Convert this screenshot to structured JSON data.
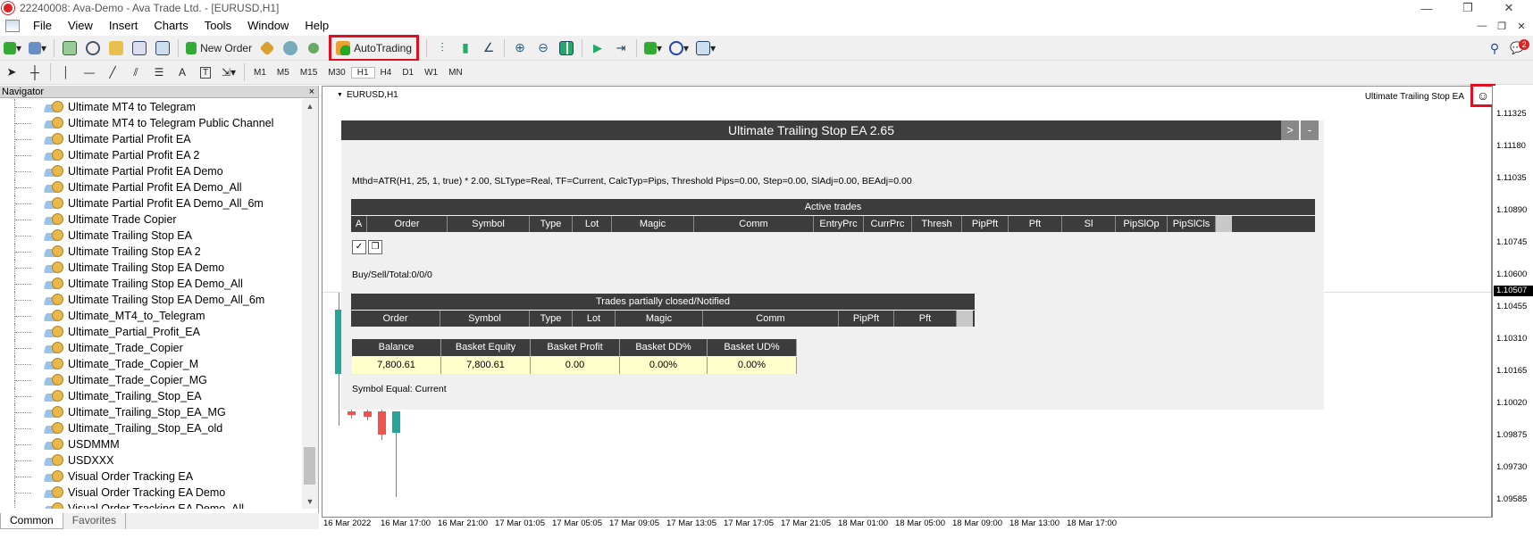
{
  "window": {
    "title": "22240008: Ava-Demo - Ava Trade Ltd. - [EURUSD,H1]",
    "controls": [
      "—",
      "❐",
      "✕"
    ]
  },
  "menu": {
    "items": [
      "File",
      "View",
      "Insert",
      "Charts",
      "Tools",
      "Window",
      "Help"
    ],
    "mdi_controls": [
      "—",
      "❐",
      "✕"
    ]
  },
  "toolbar": {
    "new_order_label": "New Order",
    "autotrading_label": "AutoTrading",
    "notification_count": "2"
  },
  "timeframes": [
    "M1",
    "M5",
    "M15",
    "M30",
    "H1",
    "H4",
    "D1",
    "W1",
    "MN"
  ],
  "navigator": {
    "title": "Navigator",
    "close": "×",
    "items": [
      "Ultimate MT4 to Telegram",
      "Ultimate MT4 to Telegram Public Channel",
      "Ultimate Partial Profit EA",
      "Ultimate Partial Profit EA 2",
      "Ultimate Partial Profit EA Demo",
      "Ultimate Partial Profit EA Demo_All",
      "Ultimate Partial Profit EA Demo_All_6m",
      "Ultimate Trade Copier",
      "Ultimate Trailing Stop EA",
      "Ultimate Trailing Stop EA 2",
      "Ultimate Trailing Stop EA Demo",
      "Ultimate Trailing Stop EA Demo_All",
      "Ultimate Trailing Stop EA Demo_All_6m",
      "Ultimate_MT4_to_Telegram",
      "Ultimate_Partial_Profit_EA",
      "Ultimate_Trade_Copier",
      "Ultimate_Trade_Copier_M",
      "Ultimate_Trade_Copier_MG",
      "Ultimate_Trailing_Stop_EA",
      "Ultimate_Trailing_Stop_EA_MG",
      "Ultimate_Trailing_Stop_EA_old",
      "USDMMM",
      "USDXXX",
      "Visual Order Tracking EA",
      "Visual Order Tracking EA Demo",
      "Visual Order Tracking EA Demo_All"
    ],
    "tabs": [
      "Common",
      "Favorites"
    ]
  },
  "chart": {
    "symbol": "EURUSD,H1",
    "ea_label": "Ultimate Trailing Stop EA",
    "smiley": "☺",
    "price_labels": [
      "1.11325",
      "1.11180",
      "1.11035",
      "1.10890",
      "1.10745",
      "1.10600",
      "1.10455",
      "1.10310",
      "1.10165",
      "1.10020",
      "1.09875",
      "1.09730",
      "1.09585"
    ],
    "current_price": "1.10507",
    "time_labels": [
      "16 Mar 2022",
      "16 Mar 17:00",
      "16 Mar 21:00",
      "17 Mar 01:05",
      "17 Mar 05:05",
      "17 Mar 09:05",
      "17 Mar 13:05",
      "17 Mar 17:05",
      "17 Mar 21:05",
      "18 Mar 01:00",
      "18 Mar 05:00",
      "18 Mar 09:00",
      "18 Mar 13:00",
      "18 Mar 17:00"
    ],
    "colors": {
      "bull": "#26a69a",
      "bear": "#ef5350"
    }
  },
  "ea_panel": {
    "title": "Ultimate Trailing Stop EA 2.65",
    "btn_expand": ">",
    "btn_minimize": "-",
    "settings": "Mthd=ATR(H1, 25, 1, true) * 2.00, SLType=Real, TF=Current, CalcTyp=Pips, Threshold Pips=0.00, Step=0.00, SlAdj=0.00, BEAdj=0.00",
    "active_trades": {
      "title": "Active trades",
      "columns": [
        "A",
        "Order",
        "Symbol",
        "Type",
        "Lot",
        "Magic",
        "Comm",
        "EntryPrc",
        "CurrPrc",
        "Thresh",
        "PipPft",
        "Pft",
        "Sl",
        "PipSlOp",
        "PipSlCls"
      ]
    },
    "buy_sell_total": "Buy/Sell/Total:0/0/0",
    "partial": {
      "title": "Trades partially closed/Notified",
      "columns": [
        "Order",
        "Symbol",
        "Type",
        "Lot",
        "Magic",
        "Comm",
        "PipPft",
        "Pft"
      ]
    },
    "balance": {
      "columns": [
        "Balance",
        "Basket Equity",
        "Basket Profit",
        "Basket DD%",
        "Basket UD%"
      ],
      "values": [
        "7,800.61",
        "7,800.61",
        "0.00",
        "0.00%",
        "0.00%"
      ]
    },
    "symbol_equal": "Symbol Equal: Current"
  }
}
